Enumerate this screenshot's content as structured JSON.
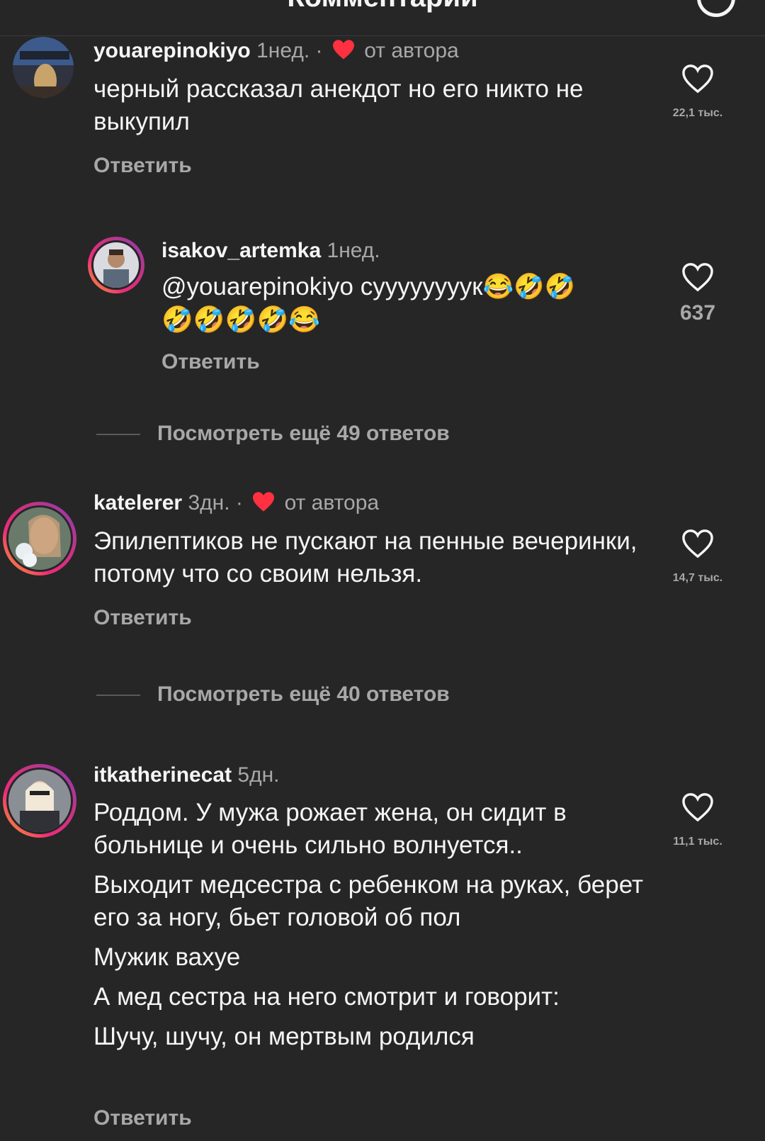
{
  "header": {
    "title": "Комментарии"
  },
  "comments": [
    {
      "username": "youarepinokiyo",
      "age": "1нед.",
      "separator": "·",
      "author_badge": "от автора",
      "text": [
        "черный рассказал анекдот но его никто не выкупил"
      ],
      "likes": "22,1 тыс.",
      "reply_label": "Ответить"
    },
    {
      "username": "isakov_artemka",
      "age": "1нед.",
      "mention": "@youarepinokiyo",
      "text_body": "суууууууук😂🤣🤣",
      "text_line2": "🤣🤣🤣🤣😂",
      "likes": "637",
      "reply_label": "Ответить"
    },
    {
      "more_replies": "Посмотреть ещё 49 ответов"
    },
    {
      "username": "katelerer",
      "age": "3дн.",
      "separator": "·",
      "author_badge": "от автора",
      "text": [
        "Эпилептиков не пускают на пенные вечеринки, потому что со своим нельзя."
      ],
      "likes": "14,7 тыс.",
      "reply_label": "Ответить"
    },
    {
      "more_replies": "Посмотреть ещё 40 ответов"
    },
    {
      "username": "itkatherinecat",
      "age": "5дн.",
      "text": [
        "Роддом. У мужа рожает жена, он сидит в больнице и очень сильно волнуется..",
        "Выходит медсестра с ребенком на руках, берет его за ногу, бьет головой об пол",
        "Мужик вахуе",
        "А мед сестра на него смотрит и говорит:",
        "Шучу, шучу, он мертвым родился"
      ],
      "likes": "11,1 тыс.",
      "reply_label": "Ответить"
    }
  ],
  "icons": {
    "heart": "heart-outline-icon",
    "author_heart": "heart-filled-icon",
    "author_heart_color": "#ff3040"
  }
}
